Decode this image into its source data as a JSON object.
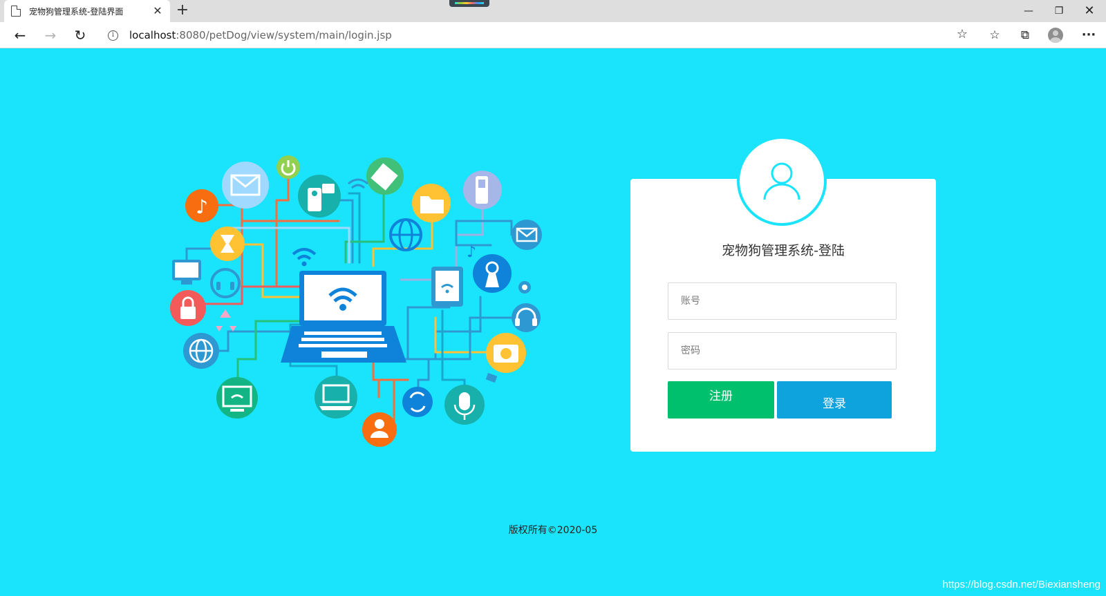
{
  "browser": {
    "tab_title": "宠物狗管理系统-登陆界面",
    "tab_close": "✕",
    "new_tab": "+",
    "url_host": "localhost",
    "url_rest": ":8080/petDog/view/system/main/login.jsp",
    "info_glyph": "i",
    "star_glyph": "☆",
    "fav_glyph": "☆",
    "coll_glyph": "⧉",
    "more_glyph": "···",
    "min_glyph": "—",
    "max_glyph": "❐",
    "close_glyph": "✕",
    "back_glyph": "←",
    "fwd_glyph": "→",
    "reload_glyph": "↻"
  },
  "login": {
    "title": "宠物狗管理系统-登陆",
    "username_placeholder": "账号",
    "password_placeholder": "密码",
    "register_label": "注册",
    "login_label": "登录"
  },
  "footer": {
    "copyright": "版权所有©2020-05"
  },
  "watermark": "https://blog.csdn.net/Biexiansheng",
  "colors": {
    "background": "#1ae3fc",
    "register": "#00bf6d",
    "login": "#0fa3de"
  }
}
